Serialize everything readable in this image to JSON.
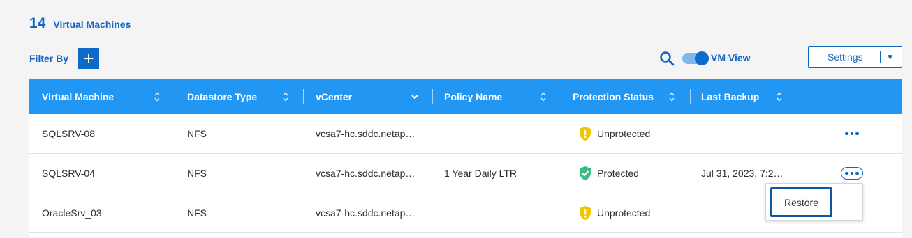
{
  "header": {
    "count": "14",
    "count_label": "Virtual Machines",
    "filter_label": "Filter By",
    "filter_add": "+",
    "view_toggle_label": "VM View",
    "view_toggle_on": true,
    "settings_label": "Settings",
    "settings_caret": "▼"
  },
  "icons": {
    "search": "search-icon",
    "add": "plus-icon",
    "sort": "sort-updown-icon",
    "dropdown": "chevron-down-icon",
    "unprotected": "shield-exclamation-icon",
    "protected": "shield-check-icon",
    "more": "more-horizontal-icon"
  },
  "colors": {
    "accent": "#1166c4",
    "header_bg": "#2196f3",
    "warning": "#f2c500",
    "success": "#3dbb86"
  },
  "table": {
    "columns": [
      {
        "label": "Virtual Machine",
        "control": "sort"
      },
      {
        "label": "Datastore Type",
        "control": "sort"
      },
      {
        "label": "vCenter",
        "control": "dropdown"
      },
      {
        "label": "Policy Name",
        "control": "sort"
      },
      {
        "label": "Protection Status",
        "control": "sort"
      },
      {
        "label": "Last Backup",
        "control": "sort"
      }
    ],
    "rows": [
      {
        "vm": "SQLSRV-08",
        "datastore": "NFS",
        "vcenter": "vcsa7-hc.sddc.netap…",
        "policy": "",
        "status": "Unprotected",
        "last_backup": ""
      },
      {
        "vm": "SQLSRV-04",
        "datastore": "NFS",
        "vcenter": "vcsa7-hc.sddc.netap…",
        "policy": "1 Year Daily LTR",
        "status": "Protected",
        "last_backup": "Jul 31, 2023, 7:2…"
      },
      {
        "vm": "OracleSrv_03",
        "datastore": "NFS",
        "vcenter": "vcsa7-hc.sddc.netap…",
        "policy": "",
        "status": "Unprotected",
        "last_backup": ""
      }
    ]
  },
  "row_menu": {
    "items": [
      "Restore"
    ]
  }
}
